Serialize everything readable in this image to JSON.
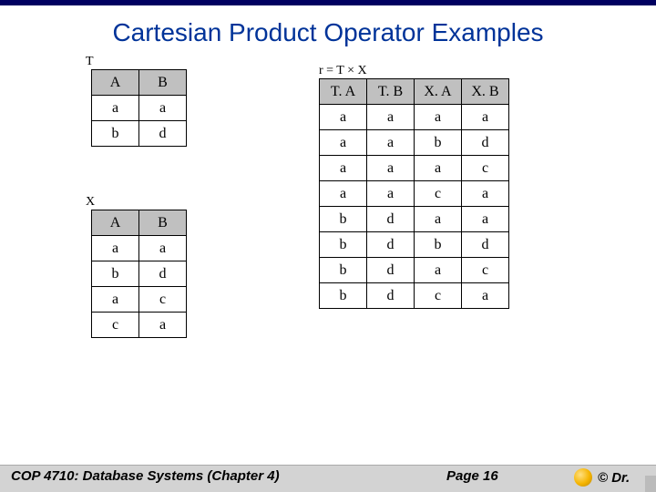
{
  "title": "Cartesian Product Operator Examples",
  "tables": {
    "T": {
      "label": "T",
      "headers": [
        "A",
        "B"
      ],
      "rows": [
        [
          "a",
          "a"
        ],
        [
          "b",
          "d"
        ]
      ]
    },
    "X": {
      "label": "X",
      "headers": [
        "A",
        "B"
      ],
      "rows": [
        [
          "a",
          "a"
        ],
        [
          "b",
          "d"
        ],
        [
          "a",
          "c"
        ],
        [
          "c",
          "a"
        ]
      ]
    },
    "R": {
      "label": "r = T × X",
      "headers": [
        "T. A",
        "T. B",
        "X. A",
        "X. B"
      ],
      "rows": [
        [
          "a",
          "a",
          "a",
          "a"
        ],
        [
          "a",
          "a",
          "b",
          "d"
        ],
        [
          "a",
          "a",
          "a",
          "c"
        ],
        [
          "a",
          "a",
          "c",
          "a"
        ],
        [
          "b",
          "d",
          "a",
          "a"
        ],
        [
          "b",
          "d",
          "b",
          "d"
        ],
        [
          "b",
          "d",
          "a",
          "c"
        ],
        [
          "b",
          "d",
          "c",
          "a"
        ]
      ]
    }
  },
  "footer": {
    "course": "COP 4710: Database Systems  (Chapter 4)",
    "page": "Page 16",
    "copyright": "© Dr."
  },
  "chart_data": {
    "type": "table",
    "description": "Cartesian product r = T × X of relations T(A,B) and X(A,B)",
    "T": {
      "schema": [
        "A",
        "B"
      ],
      "tuples": [
        [
          "a",
          "a"
        ],
        [
          "b",
          "d"
        ]
      ]
    },
    "X": {
      "schema": [
        "A",
        "B"
      ],
      "tuples": [
        [
          "a",
          "a"
        ],
        [
          "b",
          "d"
        ],
        [
          "a",
          "c"
        ],
        [
          "c",
          "a"
        ]
      ]
    },
    "r": {
      "schema": [
        "T.A",
        "T.B",
        "X.A",
        "X.B"
      ],
      "tuples": [
        [
          "a",
          "a",
          "a",
          "a"
        ],
        [
          "a",
          "a",
          "b",
          "d"
        ],
        [
          "a",
          "a",
          "a",
          "c"
        ],
        [
          "a",
          "a",
          "c",
          "a"
        ],
        [
          "b",
          "d",
          "a",
          "a"
        ],
        [
          "b",
          "d",
          "b",
          "d"
        ],
        [
          "b",
          "d",
          "a",
          "c"
        ],
        [
          "b",
          "d",
          "c",
          "a"
        ]
      ]
    }
  }
}
